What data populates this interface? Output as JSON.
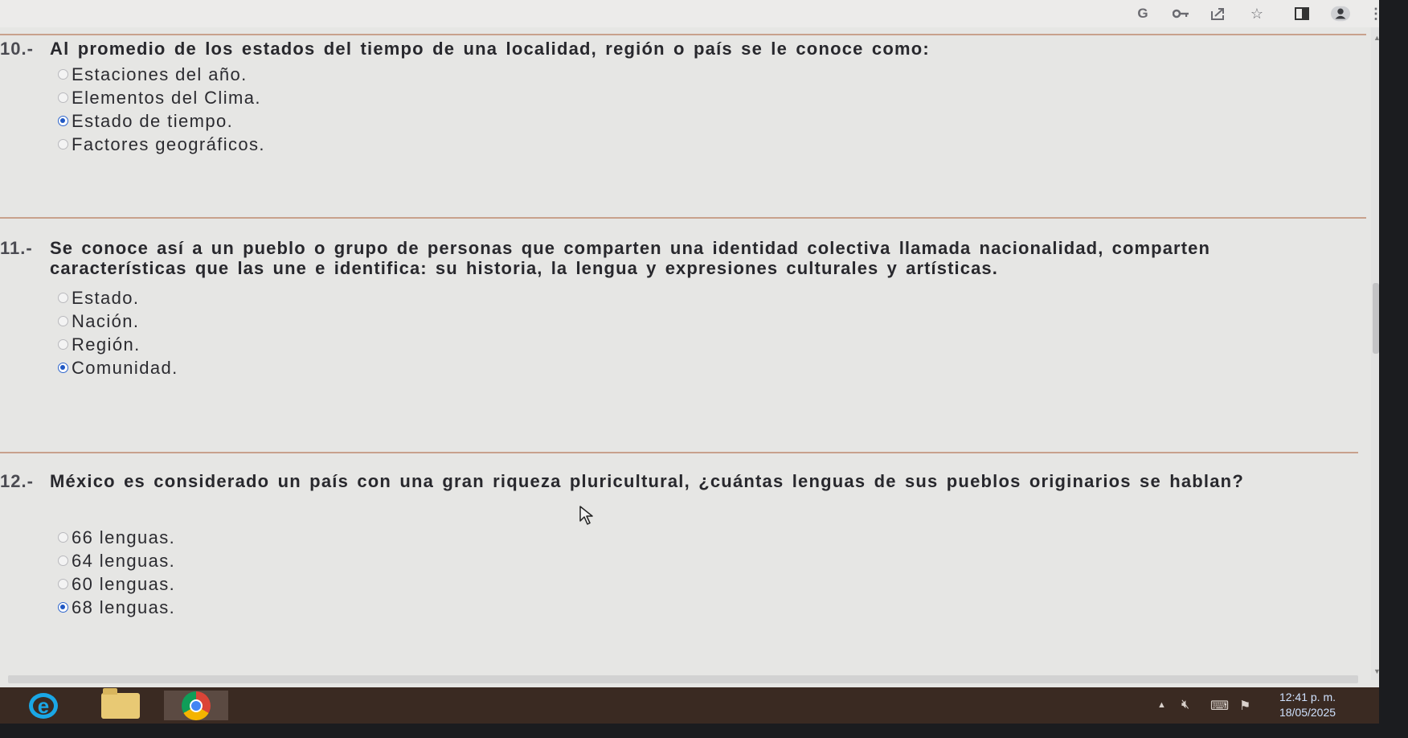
{
  "toolbar": {
    "icons": [
      "google-icon",
      "key-icon",
      "share-icon",
      "star-icon",
      "sidebar-icon",
      "profile-icon",
      "more-menu-icon"
    ]
  },
  "questions": [
    {
      "number": "10.-",
      "text": "Al promedio de los estados del tiempo de una localidad, región o país se le conoce como:",
      "options": [
        {
          "label": "Estaciones del año.",
          "selected": false
        },
        {
          "label": "Elementos del Clima.",
          "selected": false
        },
        {
          "label": "Estado de tiempo.",
          "selected": true
        },
        {
          "label": "Factores geográficos.",
          "selected": false
        }
      ]
    },
    {
      "number": "11.-",
      "text": "Se conoce así a un pueblo o grupo de personas que comparten una identidad colectiva llamada nacionalidad, comparten características que las une e identifica: su historia, la lengua y expresiones culturales y artísticas.",
      "options": [
        {
          "label": "Estado.",
          "selected": false
        },
        {
          "label": "Nación.",
          "selected": false
        },
        {
          "label": "Región.",
          "selected": false
        },
        {
          "label": "Comunidad.",
          "selected": true
        }
      ]
    },
    {
      "number": "12.-",
      "text": "México es considerado un país con una gran riqueza pluricultural, ¿cuántas lenguas de sus pueblos originarios se hablan?",
      "options": [
        {
          "label": "66 lenguas.",
          "selected": false
        },
        {
          "label": "64 lenguas.",
          "selected": false
        },
        {
          "label": "60 lenguas.",
          "selected": false
        },
        {
          "label": "68 lenguas.",
          "selected": true
        }
      ]
    }
  ],
  "taskbar": {
    "apps": [
      "internet-explorer",
      "file-explorer",
      "chrome"
    ],
    "active_app": "chrome",
    "time": "12:41 p. m.",
    "date": "18/05/2025"
  },
  "colors": {
    "accent_radio": "#2058c4",
    "separator": "#c8a18c",
    "taskbar": "#3a2a22"
  }
}
